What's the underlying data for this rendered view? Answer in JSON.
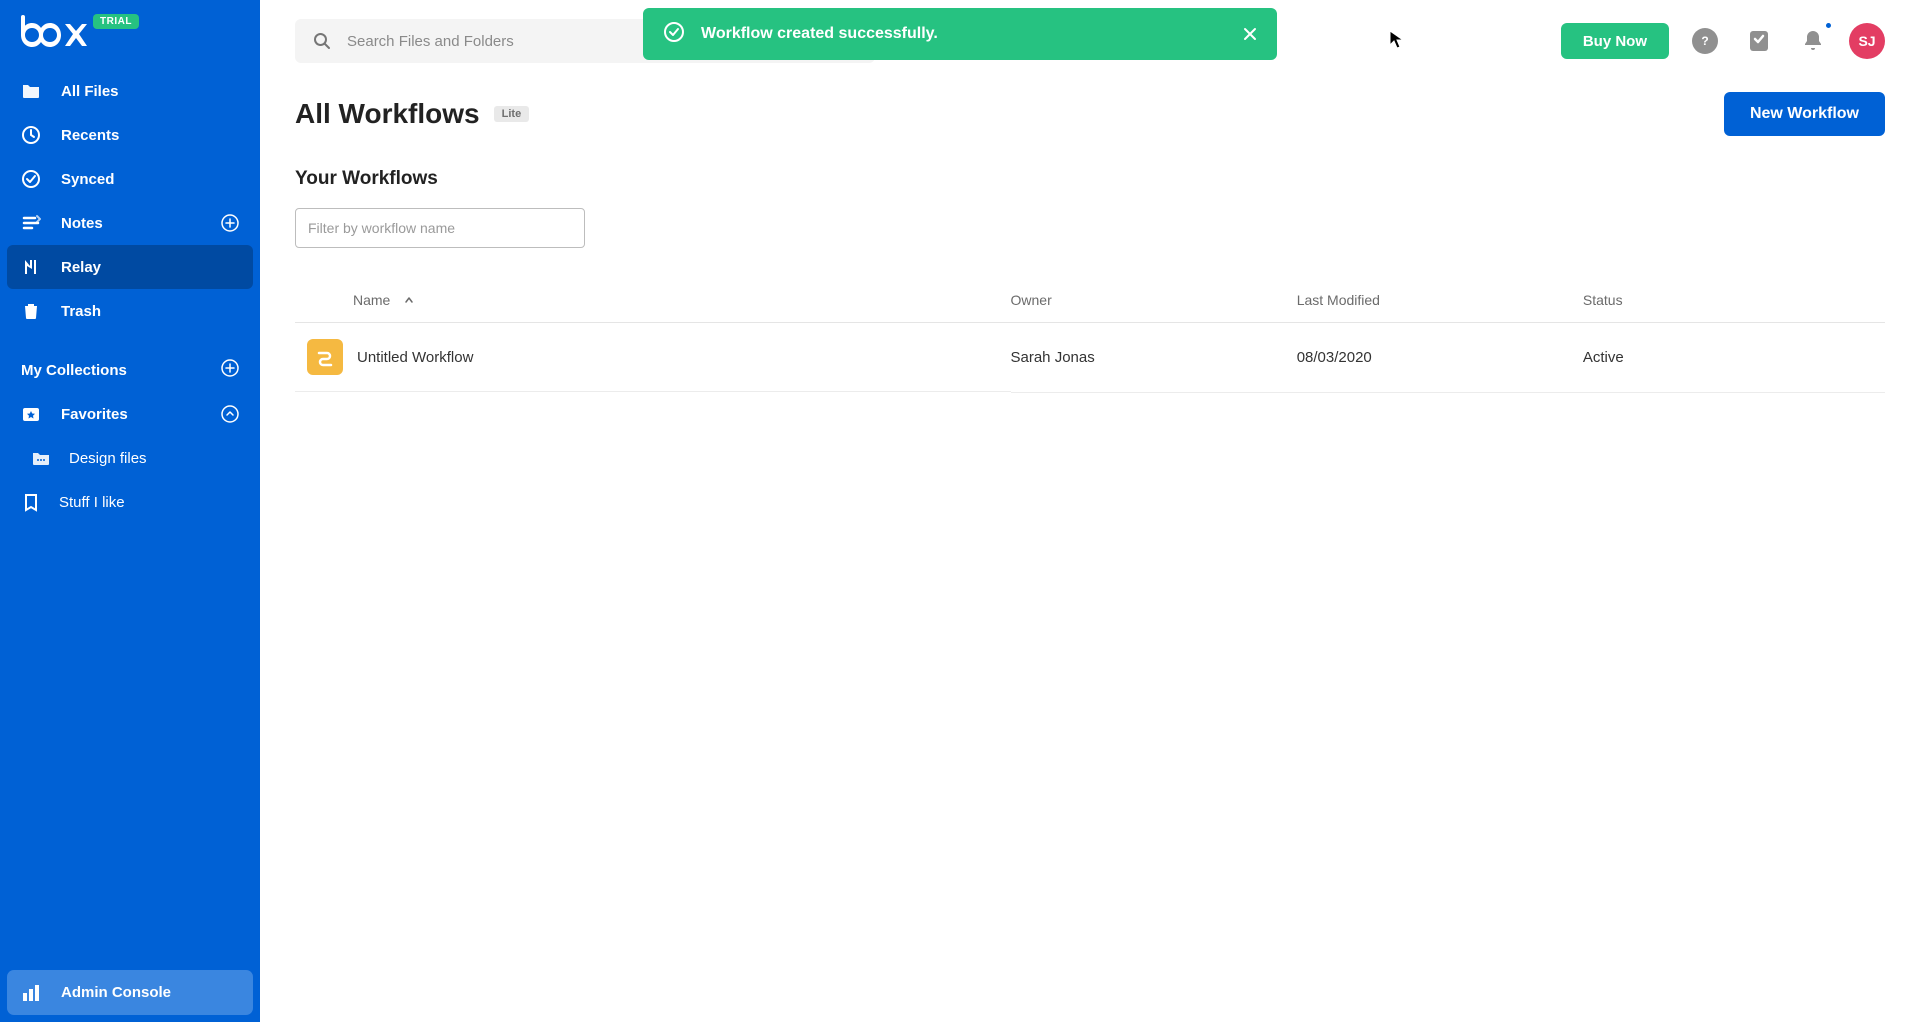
{
  "trial_badge": "TRIAL",
  "sidebar": {
    "items": [
      {
        "label": "All Files"
      },
      {
        "label": "Recents"
      },
      {
        "label": "Synced"
      },
      {
        "label": "Notes"
      },
      {
        "label": "Relay"
      },
      {
        "label": "Trash"
      }
    ],
    "collections_header": "My Collections",
    "favorites_header": "Favorites",
    "favorites": [
      {
        "label": "Design files"
      },
      {
        "label": "Stuff I like"
      }
    ],
    "admin_console": "Admin Console"
  },
  "search": {
    "placeholder": "Search Files and Folders"
  },
  "topbar": {
    "buy_now": "Buy Now",
    "avatar_initials": "SJ"
  },
  "toast": {
    "message": "Workflow created successfully."
  },
  "page": {
    "title": "All Workflows",
    "lite_badge": "Lite",
    "new_workflow": "New Workflow",
    "section_title": "Your Workflows",
    "filter_placeholder": "Filter by workflow name"
  },
  "table": {
    "columns": {
      "name": "Name",
      "owner": "Owner",
      "modified": "Last Modified",
      "status": "Status"
    },
    "rows": [
      {
        "name": "Untitled Workflow",
        "owner": "Sarah Jonas",
        "modified": "08/03/2020",
        "status": "Active"
      }
    ]
  }
}
